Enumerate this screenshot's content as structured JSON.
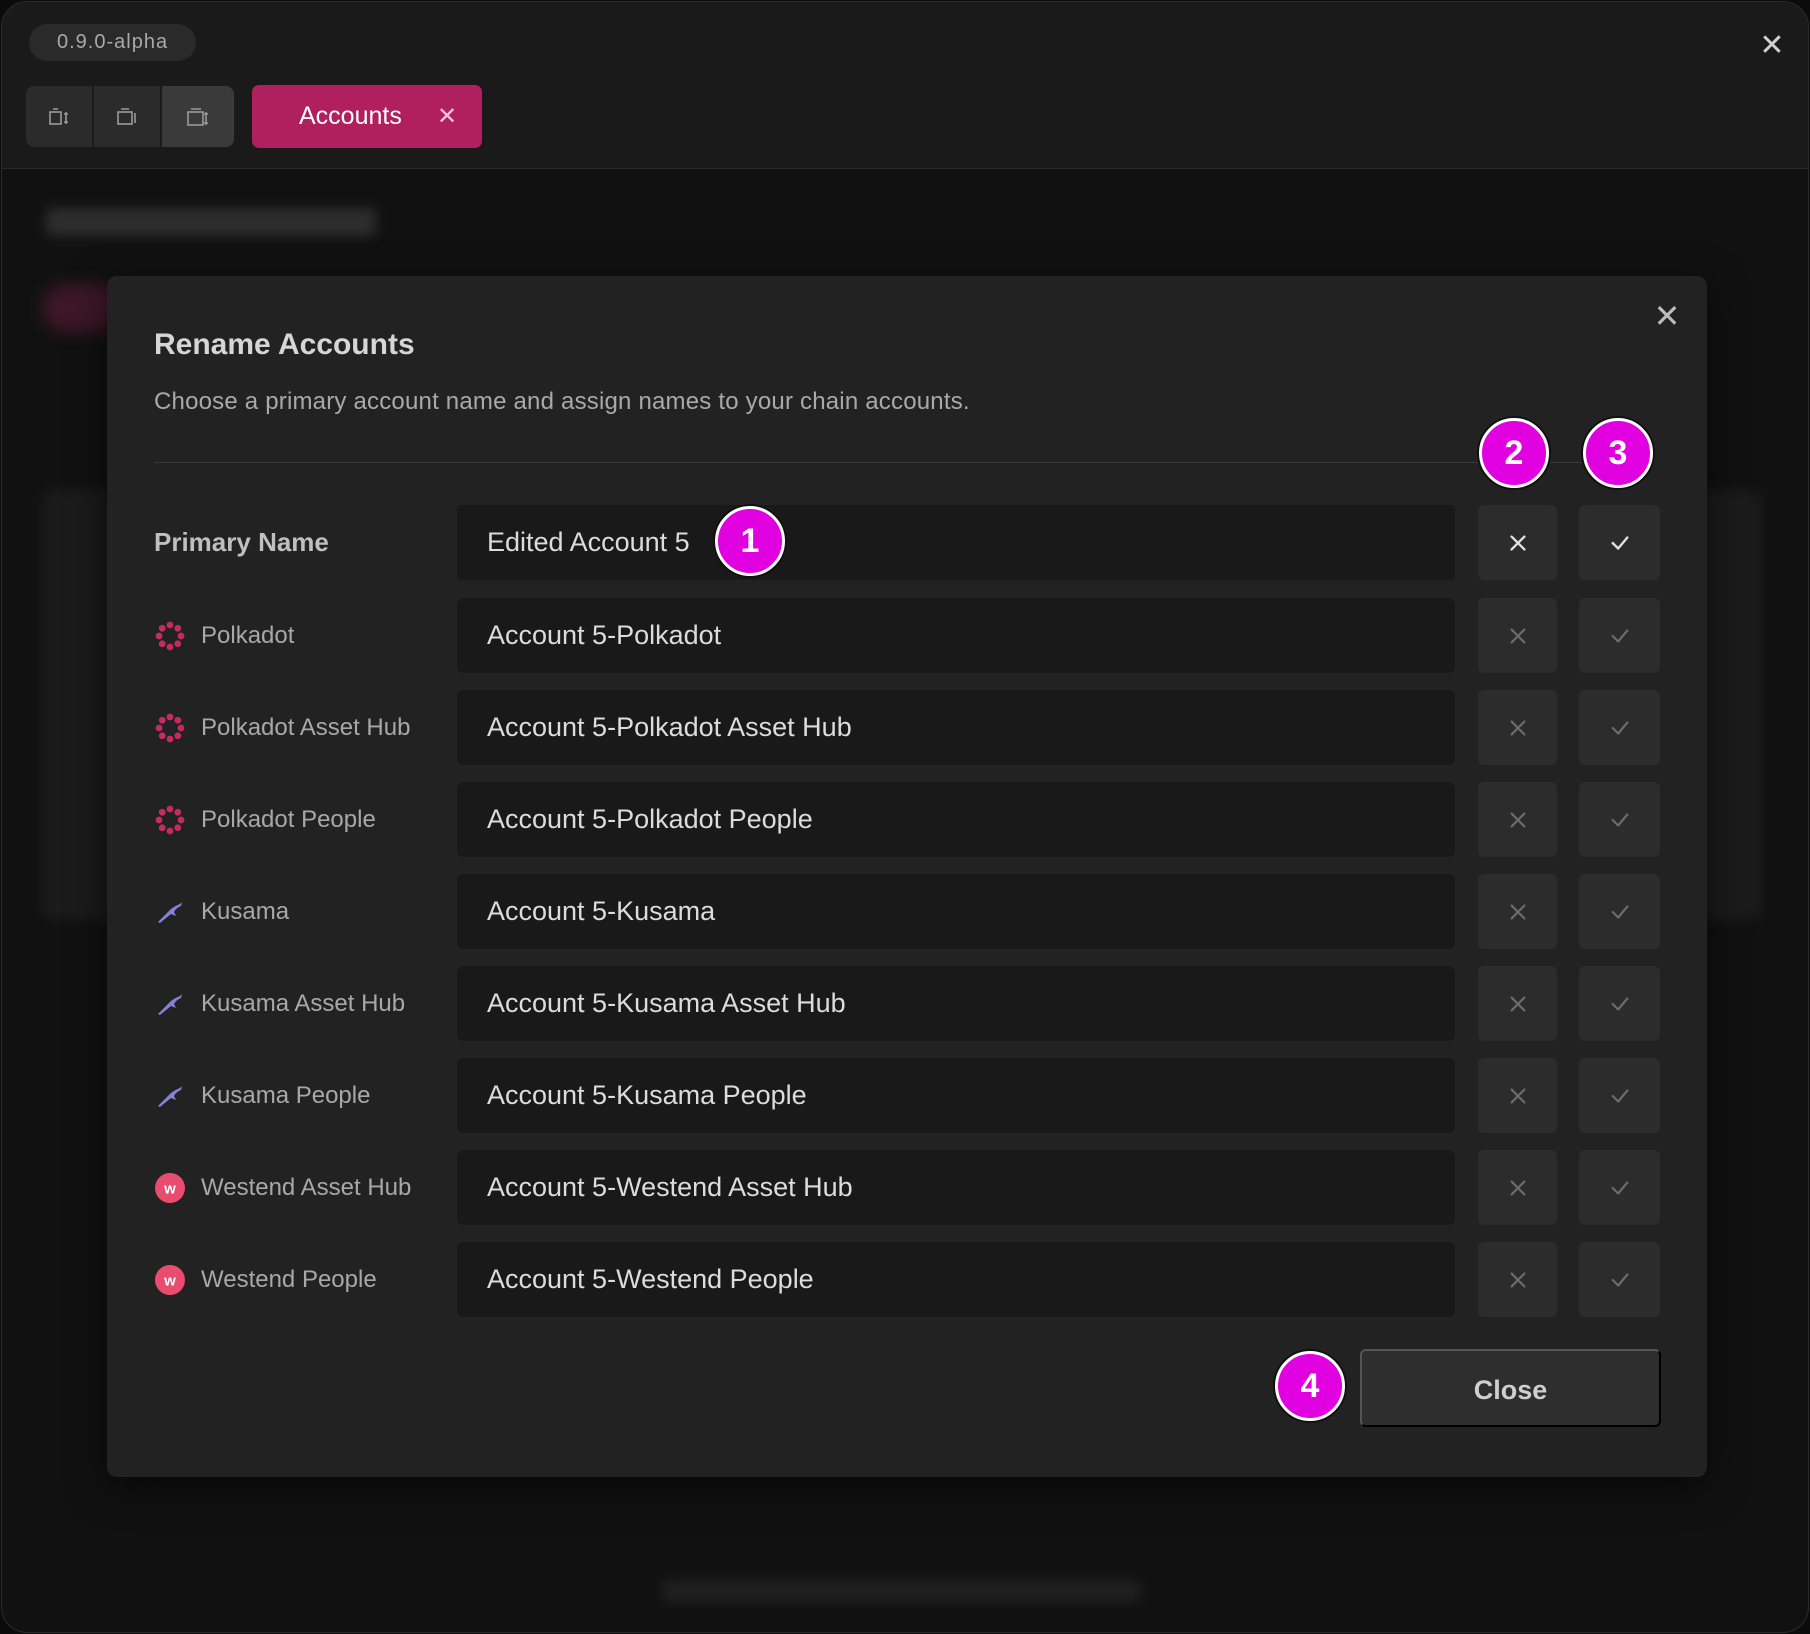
{
  "app": {
    "version": "0.9.0-alpha",
    "window_close_icon": "close-icon"
  },
  "toolbar": {
    "layout_buttons": [
      "layout-left-icon",
      "layout-center-icon",
      "layout-right-icon"
    ]
  },
  "tab": {
    "label": "Accounts",
    "close_glyph": "✕",
    "color": "#b0205f"
  },
  "modal": {
    "title": "Rename Accounts",
    "description": "Choose a primary account name and assign names to your chain accounts.",
    "close_glyph": "✕",
    "primary": {
      "label": "Primary Name",
      "value": "Edited Account 5"
    },
    "rows": [
      {
        "chain": "Polkadot",
        "icon": "polkadot-icon",
        "value": "Account 5-Polkadot"
      },
      {
        "chain": "Polkadot Asset Hub",
        "icon": "polkadot-icon",
        "value": "Account 5-Polkadot Asset Hub"
      },
      {
        "chain": "Polkadot People",
        "icon": "polkadot-icon",
        "value": "Account 5-Polkadot People"
      },
      {
        "chain": "Kusama",
        "icon": "kusama-icon",
        "value": "Account 5-Kusama"
      },
      {
        "chain": "Kusama Asset Hub",
        "icon": "kusama-icon",
        "value": "Account 5-Kusama Asset Hub"
      },
      {
        "chain": "Kusama People",
        "icon": "kusama-icon",
        "value": "Account 5-Kusama People"
      },
      {
        "chain": "Westend Asset Hub",
        "icon": "westend-icon",
        "value": "Account 5-Westend Asset Hub"
      },
      {
        "chain": "Westend People",
        "icon": "westend-icon",
        "value": "Account 5-Westend People"
      }
    ],
    "close_button": "Close"
  },
  "markers": [
    "1",
    "2",
    "3",
    "4"
  ],
  "colors": {
    "polkadot": "#c42a63",
    "kusama": "#8a7fd6",
    "westend": "#e84c6e",
    "marker": "#e000e0"
  }
}
